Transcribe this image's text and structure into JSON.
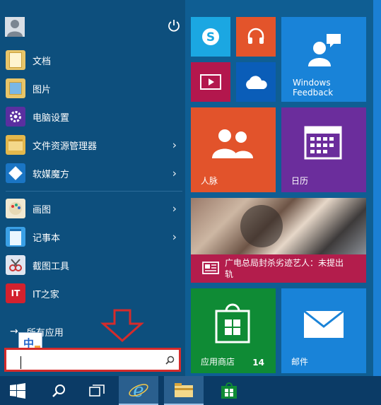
{
  "user": {
    "avatar": "avatar-icon",
    "power": "power-icon"
  },
  "apps": [
    {
      "label": "文档",
      "icon": "documents-folder-icon",
      "arrow": false
    },
    {
      "label": "图片",
      "icon": "pictures-folder-icon",
      "arrow": false
    },
    {
      "label": "电脑设置",
      "icon": "settings-gear-icon",
      "arrow": false
    },
    {
      "label": "文件资源管理器",
      "icon": "file-explorer-icon",
      "arrow": true
    },
    {
      "label": "软媒魔方",
      "icon": "ruanmei-cube-icon",
      "arrow": true
    },
    {
      "label": "画图",
      "icon": "paint-icon",
      "arrow": true
    },
    {
      "label": "记事本",
      "icon": "notepad-icon",
      "arrow": true
    },
    {
      "label": "截图工具",
      "icon": "snipping-tool-icon",
      "arrow": false
    },
    {
      "label": "IT之家",
      "icon": "ithome-icon",
      "arrow": false
    }
  ],
  "all_apps": {
    "label": "所有应用"
  },
  "ime": {
    "label": "中"
  },
  "search": {
    "placeholder": ""
  },
  "tiles": {
    "skype": {
      "icon": "skype-icon",
      "color": "#1ba7e2"
    },
    "music": {
      "icon": "headphones-icon",
      "color": "#e3542b"
    },
    "video": {
      "icon": "video-icon",
      "color": "#b3174d"
    },
    "onedrive": {
      "icon": "cloud-icon",
      "color": "#0a5db8"
    },
    "feedback": {
      "title1": "Windows",
      "title2": "Feedback",
      "icon": "feedback-person-icon",
      "color": "#1983d8"
    },
    "people": {
      "label": "人脉",
      "icon": "people-icon",
      "color": "#e2532b"
    },
    "calendar": {
      "label": "日历",
      "icon": "calendar-icon",
      "color": "#6b2d9c"
    },
    "news": {
      "headline": "广电总局封杀劣迹艺人：未提出轨",
      "icon": "news-icon",
      "color": "#b31d4c"
    },
    "store": {
      "label": "应用商店",
      "count": "14",
      "icon": "store-bag-icon",
      "color": "#0f8b35"
    },
    "mail": {
      "label": "邮件",
      "icon": "mail-icon",
      "color": "#1983d8"
    }
  },
  "taskbar": {
    "start": "windows-start-icon",
    "search": "search-icon",
    "taskview": "task-view-icon",
    "ie": "ie-icon",
    "explorer": "file-explorer-icon",
    "store": "store-icon"
  },
  "annotation": {
    "arrow_color": "#d52b2b"
  }
}
